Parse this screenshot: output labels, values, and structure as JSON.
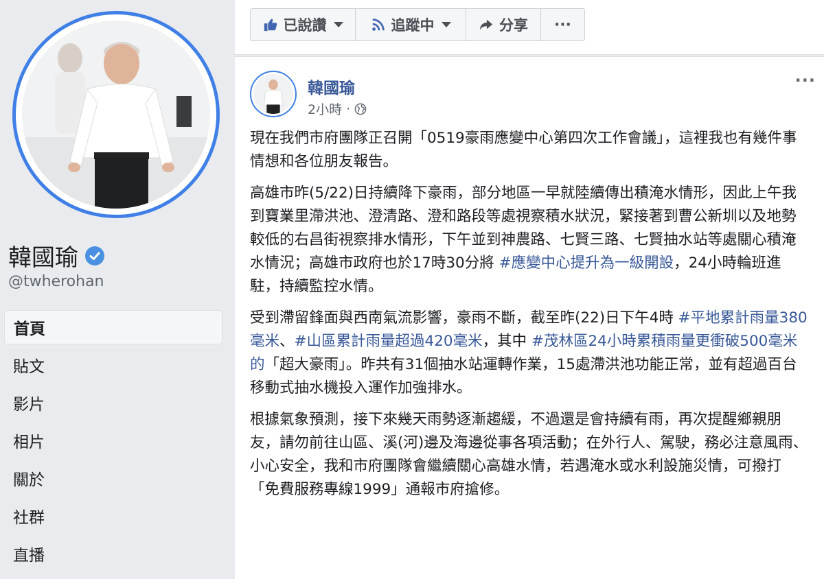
{
  "sidebar": {
    "page_name": "韓國瑜",
    "handle": "@twherohan",
    "nav": [
      {
        "label": "首頁",
        "active": true
      },
      {
        "label": "貼文"
      },
      {
        "label": "影片"
      },
      {
        "label": "相片"
      },
      {
        "label": "關於"
      },
      {
        "label": "社群"
      },
      {
        "label": "直播"
      }
    ]
  },
  "actions": {
    "liked_label": "已說讚",
    "following_label": "追蹤中",
    "share_label": "分享",
    "more_label": "···"
  },
  "post": {
    "author": "韓國瑜",
    "time": "2小時",
    "separator": "·",
    "more": "···",
    "p1": "現在我們市府團隊正召開「0519豪雨應變中心第四次工作會議」，這裡我也有幾件事情想和各位朋友報告。",
    "p2_a": "高雄市昨(5/22)日持續降下豪雨，部分地區一早就陸續傳出積淹水情形，因此上午我到寶業里滯洪池、澄清路、澄和路段等處視察積水狀況，緊接著到曹公新圳以及地勢較低的右昌街視察排水情形，下午並到神農路、七賢三路、七賢抽水站等處關心積淹水情況；高雄市政府也於17時30分將 ",
    "p2_tag": "#應變中心提升為一級開設",
    "p2_b": "，24小時輪班進駐，持續監控水情。",
    "p3_a": "受到滯留鋒面與西南氣流影響，豪雨不斷，截至昨(22)日下午4時 ",
    "p3_tag1": "#平地累計雨量380毫米",
    "p3_sep": "、",
    "p3_tag2": "#山區累計雨量超過420毫米",
    "p3_b": "，其中 ",
    "p3_tag3": "#茂林區24小時累積雨量更衝破500毫米的",
    "p3_c": "「超大豪雨」。昨共有31個抽水站運轉作業，15處滯洪池功能正常，並有超過百台移動式抽水機投入運作加強排水。",
    "p4": "根據氣象預測，接下來幾天雨勢逐漸趨緩，不過還是會持續有雨，再次提醒鄉親朋友，請勿前往山區、溪(河)邊及海邊從事各項活動；在外行人、駕駛，務必注意風雨、小心安全，我和市府團隊會繼續關心高雄水情，若遇淹水或水利設施災情，可撥打「免費服務專線1999」通報市府搶修。"
  },
  "colors": {
    "link": "#385898",
    "ring": "#4080e6",
    "background": "#e9ebee"
  }
}
